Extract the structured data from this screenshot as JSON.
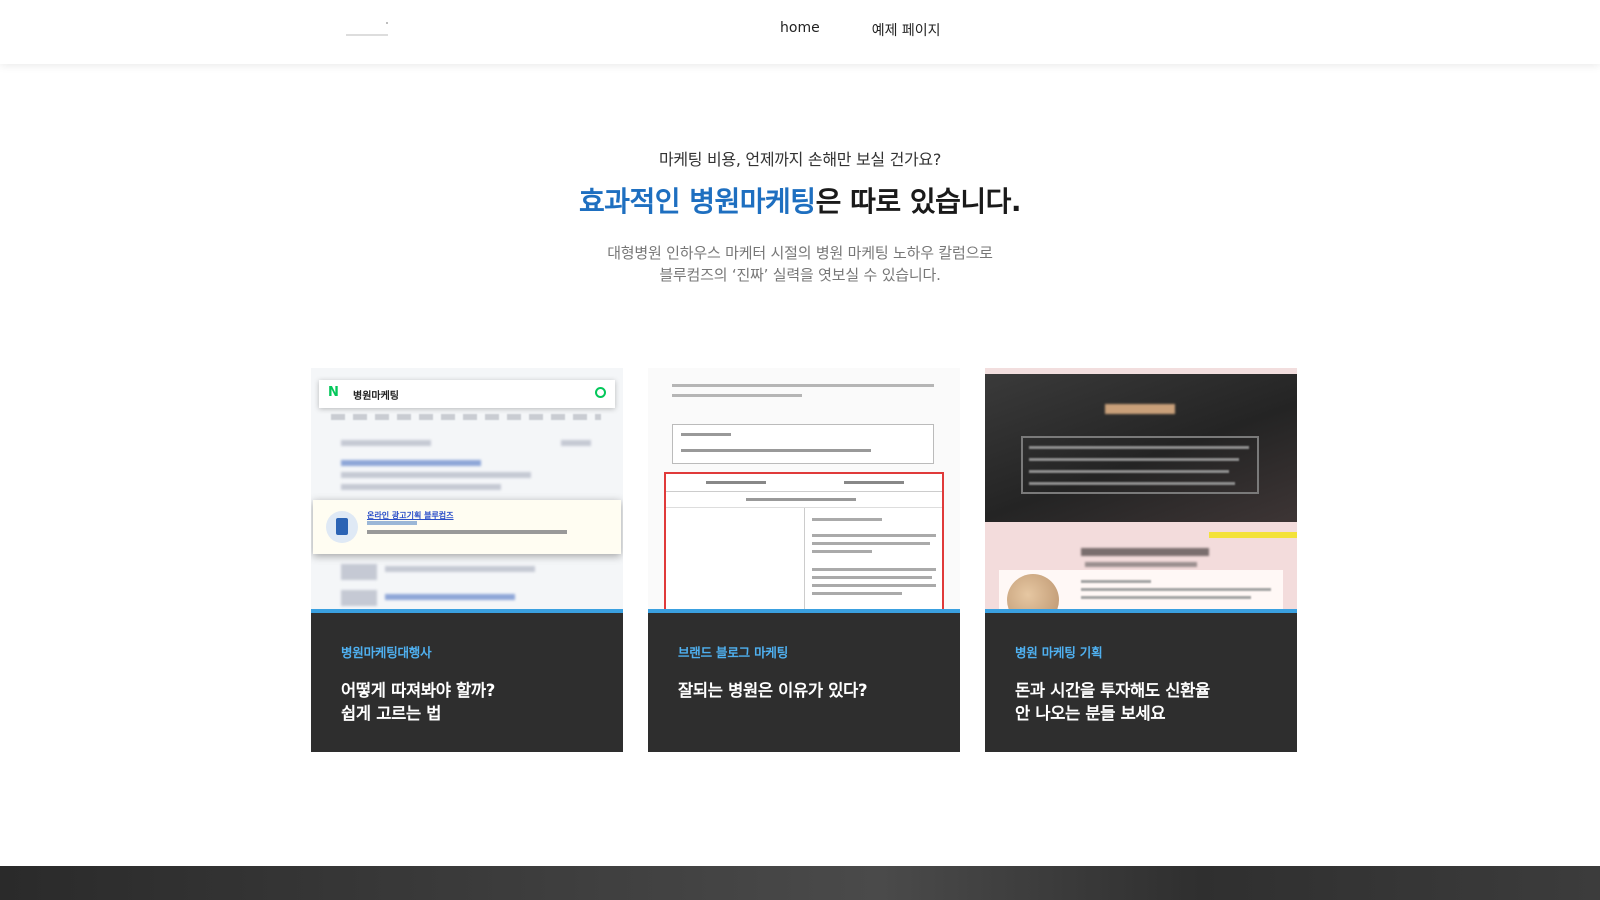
{
  "header": {
    "nav": [
      {
        "label": "home"
      },
      {
        "label": "예제 페이지"
      }
    ]
  },
  "hero": {
    "pre": "마케팅 비용, 언제까지 손해만 보실 건가요?",
    "title_accent": "효과적인 병원마케팅",
    "title_rest": "은 따로 있습니다.",
    "desc_line1": "대형병원 인하우스 마케터 시절의 병원 마케팅 노하우 칼럼으로",
    "desc_line2": "블루컴즈의 ‘진짜’ 실력을 엿보실 수 있습니다."
  },
  "cards": [
    {
      "category": "병원마케팅대행사",
      "title_line1": "어떻게 따져봐야 할까?",
      "title_line2": "쉽게 고르는 법",
      "thumb": {
        "search_query": "병원마케팅",
        "naver_logo": "N",
        "ad_title": "온라인 광고기획 블루컴즈"
      }
    },
    {
      "category": "브랜드 블로그 마케팅",
      "title_line1": "잘되는 병원은 이유가 있다?",
      "title_line2": ""
    },
    {
      "category": "병원 마케팅 기획",
      "title_line1": "돈과 시간을 투자해도 신환율",
      "title_line2": "안 나오는 분들 보세요"
    }
  ],
  "colors": {
    "accent": "#1e6fc0",
    "category": "#4fb0f0",
    "card_bg": "#2e2e2e",
    "thumb_border": "#3aa0e0"
  }
}
